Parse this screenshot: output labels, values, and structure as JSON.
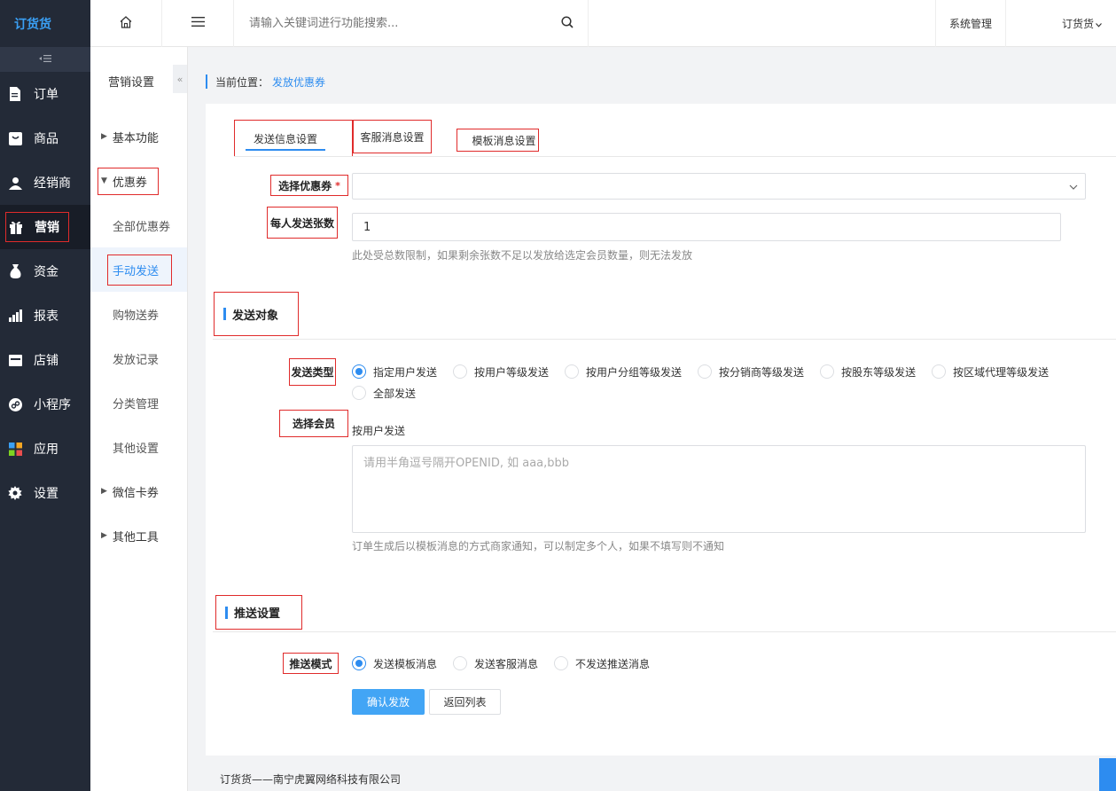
{
  "app": {
    "logo_text": "订货货"
  },
  "sidebar": {
    "items": [
      {
        "label": "订单",
        "icon": "document-icon"
      },
      {
        "label": "商品",
        "icon": "product-icon"
      },
      {
        "label": "经销商",
        "icon": "user-icon"
      },
      {
        "label": "营销",
        "icon": "gift-icon"
      },
      {
        "label": "资金",
        "icon": "money-bag-icon"
      },
      {
        "label": "报表",
        "icon": "bar-chart-icon"
      },
      {
        "label": "店铺",
        "icon": "store-icon"
      },
      {
        "label": "小程序",
        "icon": "mini-program-icon"
      },
      {
        "label": "应用",
        "icon": "apps-icon"
      },
      {
        "label": "设置",
        "icon": "gear-icon"
      }
    ]
  },
  "submenu": {
    "title": "营销设置",
    "basic": "基本功能",
    "coupon": "优惠券",
    "all_coupons": "全部优惠券",
    "manual_send": "手动发送",
    "shopping_coupon": "购物送券",
    "send_record": "发放记录",
    "category_mgmt": "分类管理",
    "other_settings": "其他设置",
    "wechat_card": "微信卡券",
    "other_tools": "其他工具"
  },
  "topbar": {
    "search_placeholder": "请输入关键词进行功能搜索...",
    "system_mgmt": "系统管理",
    "user_name": "订货货"
  },
  "breadcrumb": {
    "prefix": "当前位置：",
    "current": "发放优惠券"
  },
  "tabs": [
    "发送信息设置",
    "客服消息设置",
    "模板消息设置"
  ],
  "form": {
    "select_coupon_label": "选择优惠券",
    "required_mark": "*",
    "per_person_label": "每人发送张数",
    "per_person_value": "1",
    "per_person_hint": "此处受总数限制，如果剩余张数不足以发放给选定会员数量，则无法发放"
  },
  "target": {
    "section_title": "发送对象",
    "type_label": "发送类型",
    "types": [
      "指定用户发送",
      "按用户等级发送",
      "按用户分组等级发送",
      "按分销商等级发送",
      "按股东等级发送",
      "按区域代理等级发送",
      "全部发送"
    ],
    "member_label": "选择会员",
    "member_sub_label": "按用户发送",
    "member_placeholder": "请用半角逗号隔开OPENID, 如 aaa,bbb",
    "member_hint": "订单生成后以模板消息的方式商家通知，可以制定多个人，如果不填写则不通知"
  },
  "push": {
    "section_title": "推送设置",
    "mode_label": "推送模式",
    "modes": [
      "发送模板消息",
      "发送客服消息",
      "不发送推送消息"
    ]
  },
  "actions": {
    "confirm": "确认发放",
    "back": "返回列表"
  },
  "footer": {
    "text": "订货货——南宁虎翼网络科技有限公司"
  }
}
